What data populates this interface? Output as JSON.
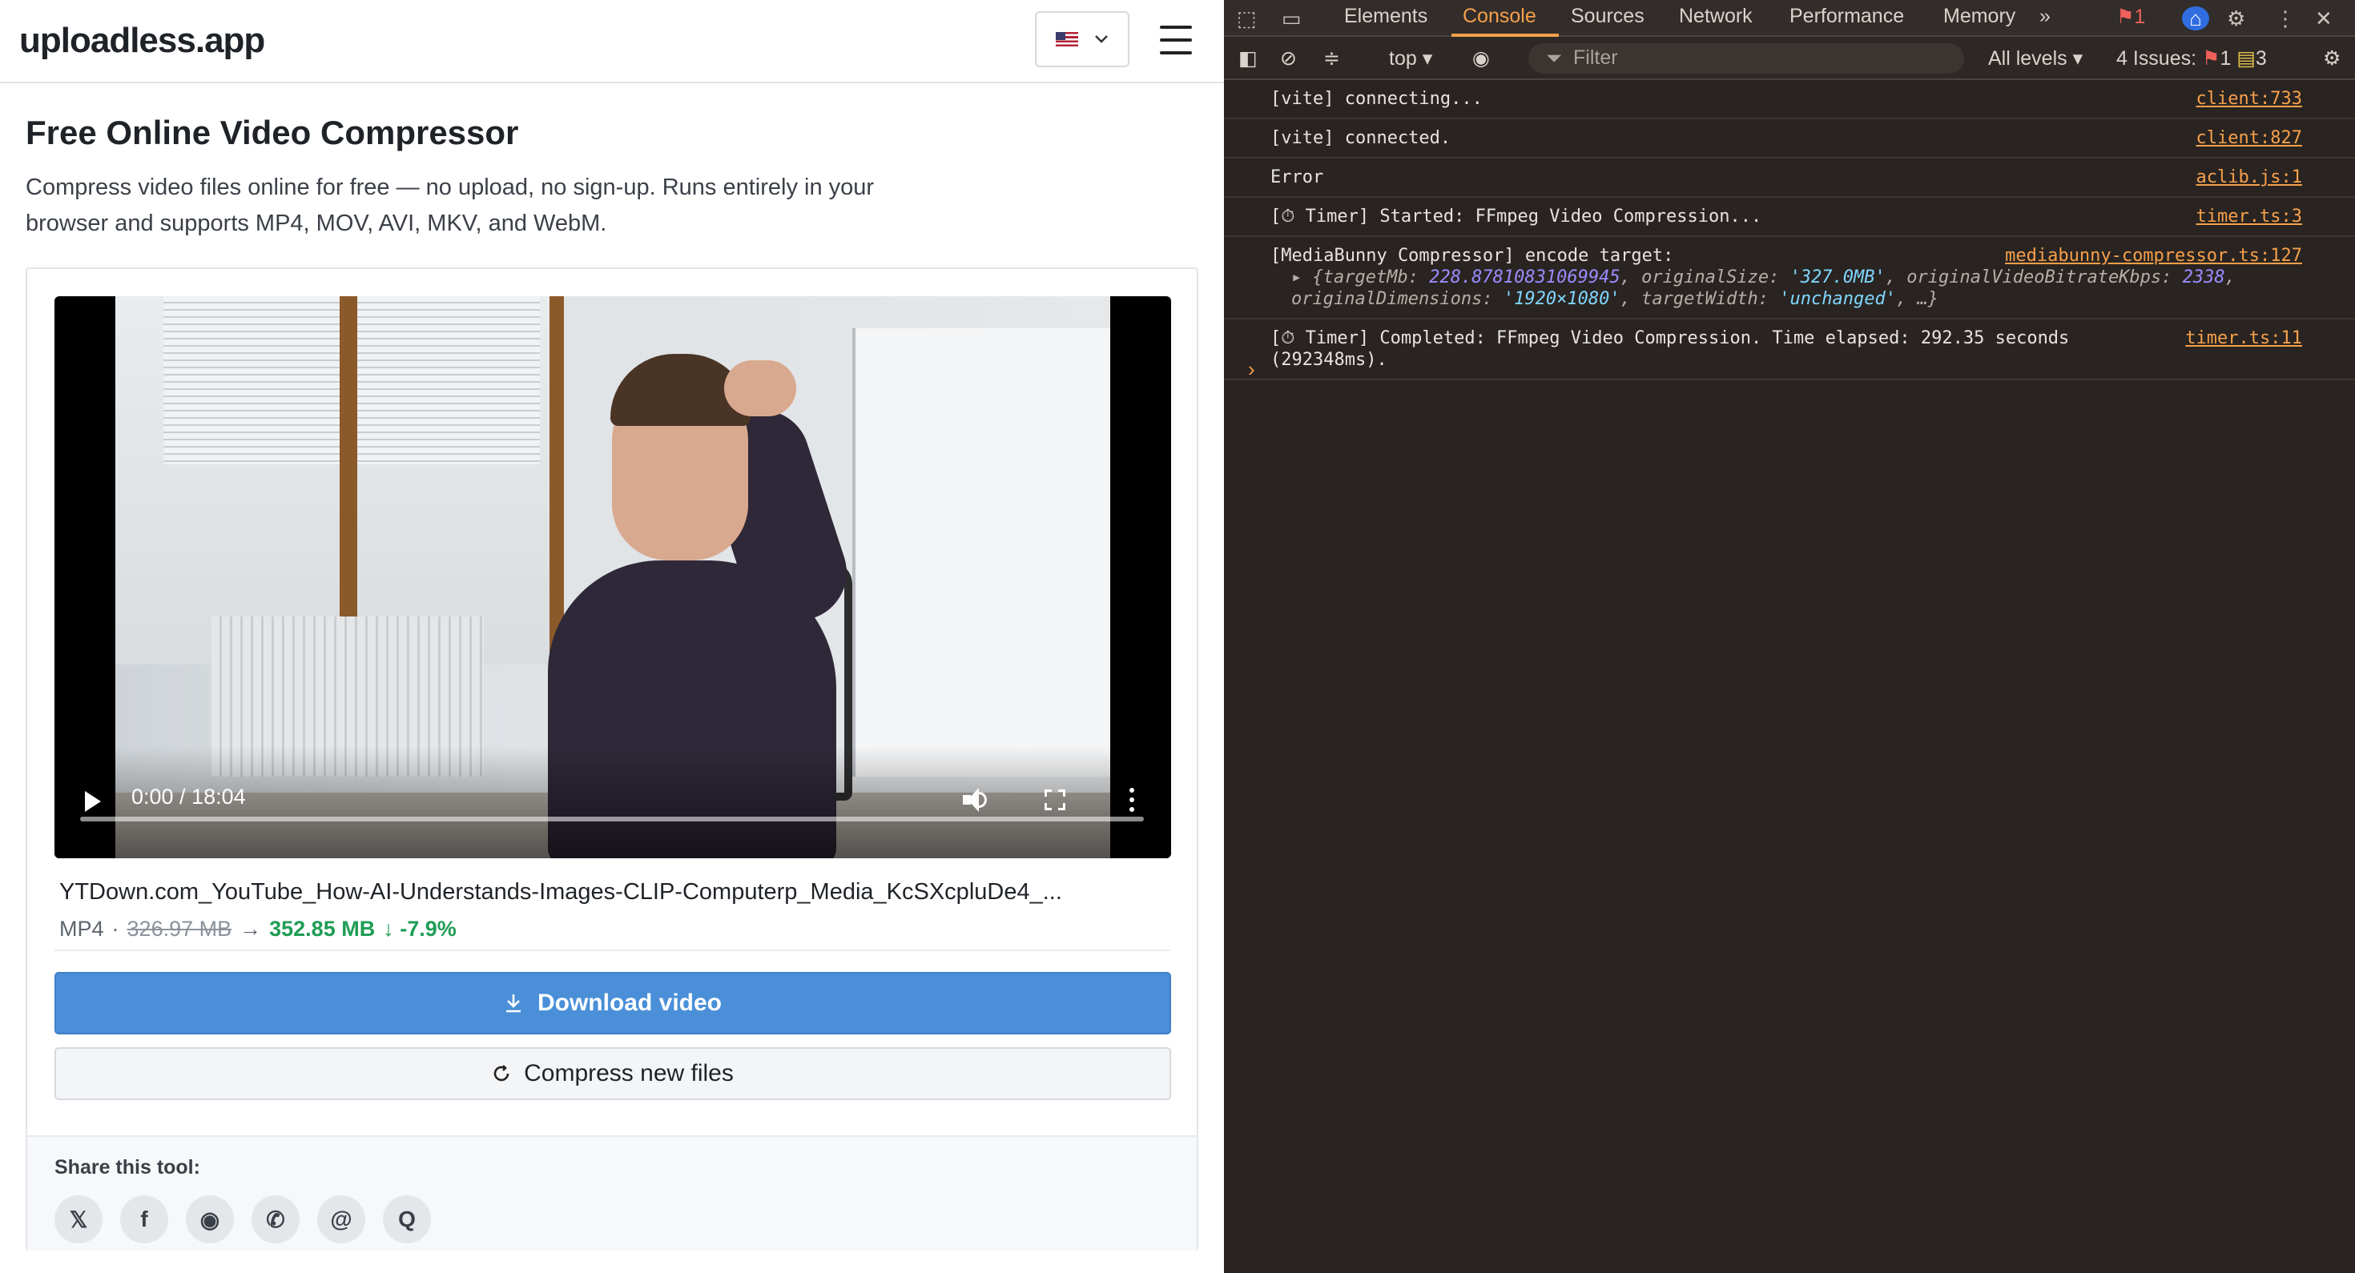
{
  "site": {
    "logo": "uploadless.app",
    "menu_icon": "hamburger-menu-icon",
    "lang_flag": "us-flag-icon"
  },
  "hero": {
    "title": "Free Online Video Compressor",
    "description": "Compress video files online for free — no upload, no sign-up. Runs entirely in your browser and supports MP4, MOV, AVI, MKV, and WebM."
  },
  "player": {
    "time": "0:00 / 18:04",
    "progress": 0
  },
  "file": {
    "name": "YTDown.com_YouTube_How-AI-Understands-Images-CLIP-Computerp_Media_KcSXcpluDe4_...",
    "format": "MP4",
    "original_size": "326.97 MB",
    "arrow": "→",
    "new_size": "352.85 MB",
    "change": "↓ -7.9%"
  },
  "actions": {
    "download": "Download video",
    "compress_new": "Compress new files"
  },
  "share": {
    "title": "Share this tool:",
    "icons": [
      "x-icon",
      "facebook-icon",
      "reddit-icon",
      "whatsapp-icon",
      "threads-icon",
      "quora-icon"
    ]
  },
  "devtools": {
    "tabs": [
      "Elements",
      "Console",
      "Sources",
      "Network",
      "Performance",
      "Memory"
    ],
    "active_tab": "Console",
    "error_count": "1",
    "context": "top",
    "filter_placeholder": "Filter",
    "levels": "All levels",
    "issues_label": "4 Issues:",
    "issues_errors": "1",
    "issues_warnings": "3",
    "logs": [
      {
        "text": "[vite] connecting...",
        "source": "client:733"
      },
      {
        "text": "[vite] connected.",
        "source": "client:827"
      },
      {
        "text": "Error",
        "source": "aclib.js:1"
      },
      {
        "text": "[⏱ Timer] Started: FFmpeg Video Compression...",
        "source": "timer.ts:3"
      },
      {
        "text": "[MediaBunny Compressor] encode target:",
        "source": "mediabunny-compressor.ts:127",
        "object": {
          "targetMb": "228.87810831069945",
          "originalSize": "'327.0MB'",
          "originalVideoBitrateKbps": "2338",
          "originalDimensions": "'1920×1080'",
          "targetWidth": "'unchanged'"
        }
      },
      {
        "text": "[⏱ Timer] Completed: FFmpeg Video Compression. Time elapsed: 292.35 seconds (292348ms).",
        "source": "timer.ts:11"
      }
    ]
  }
}
